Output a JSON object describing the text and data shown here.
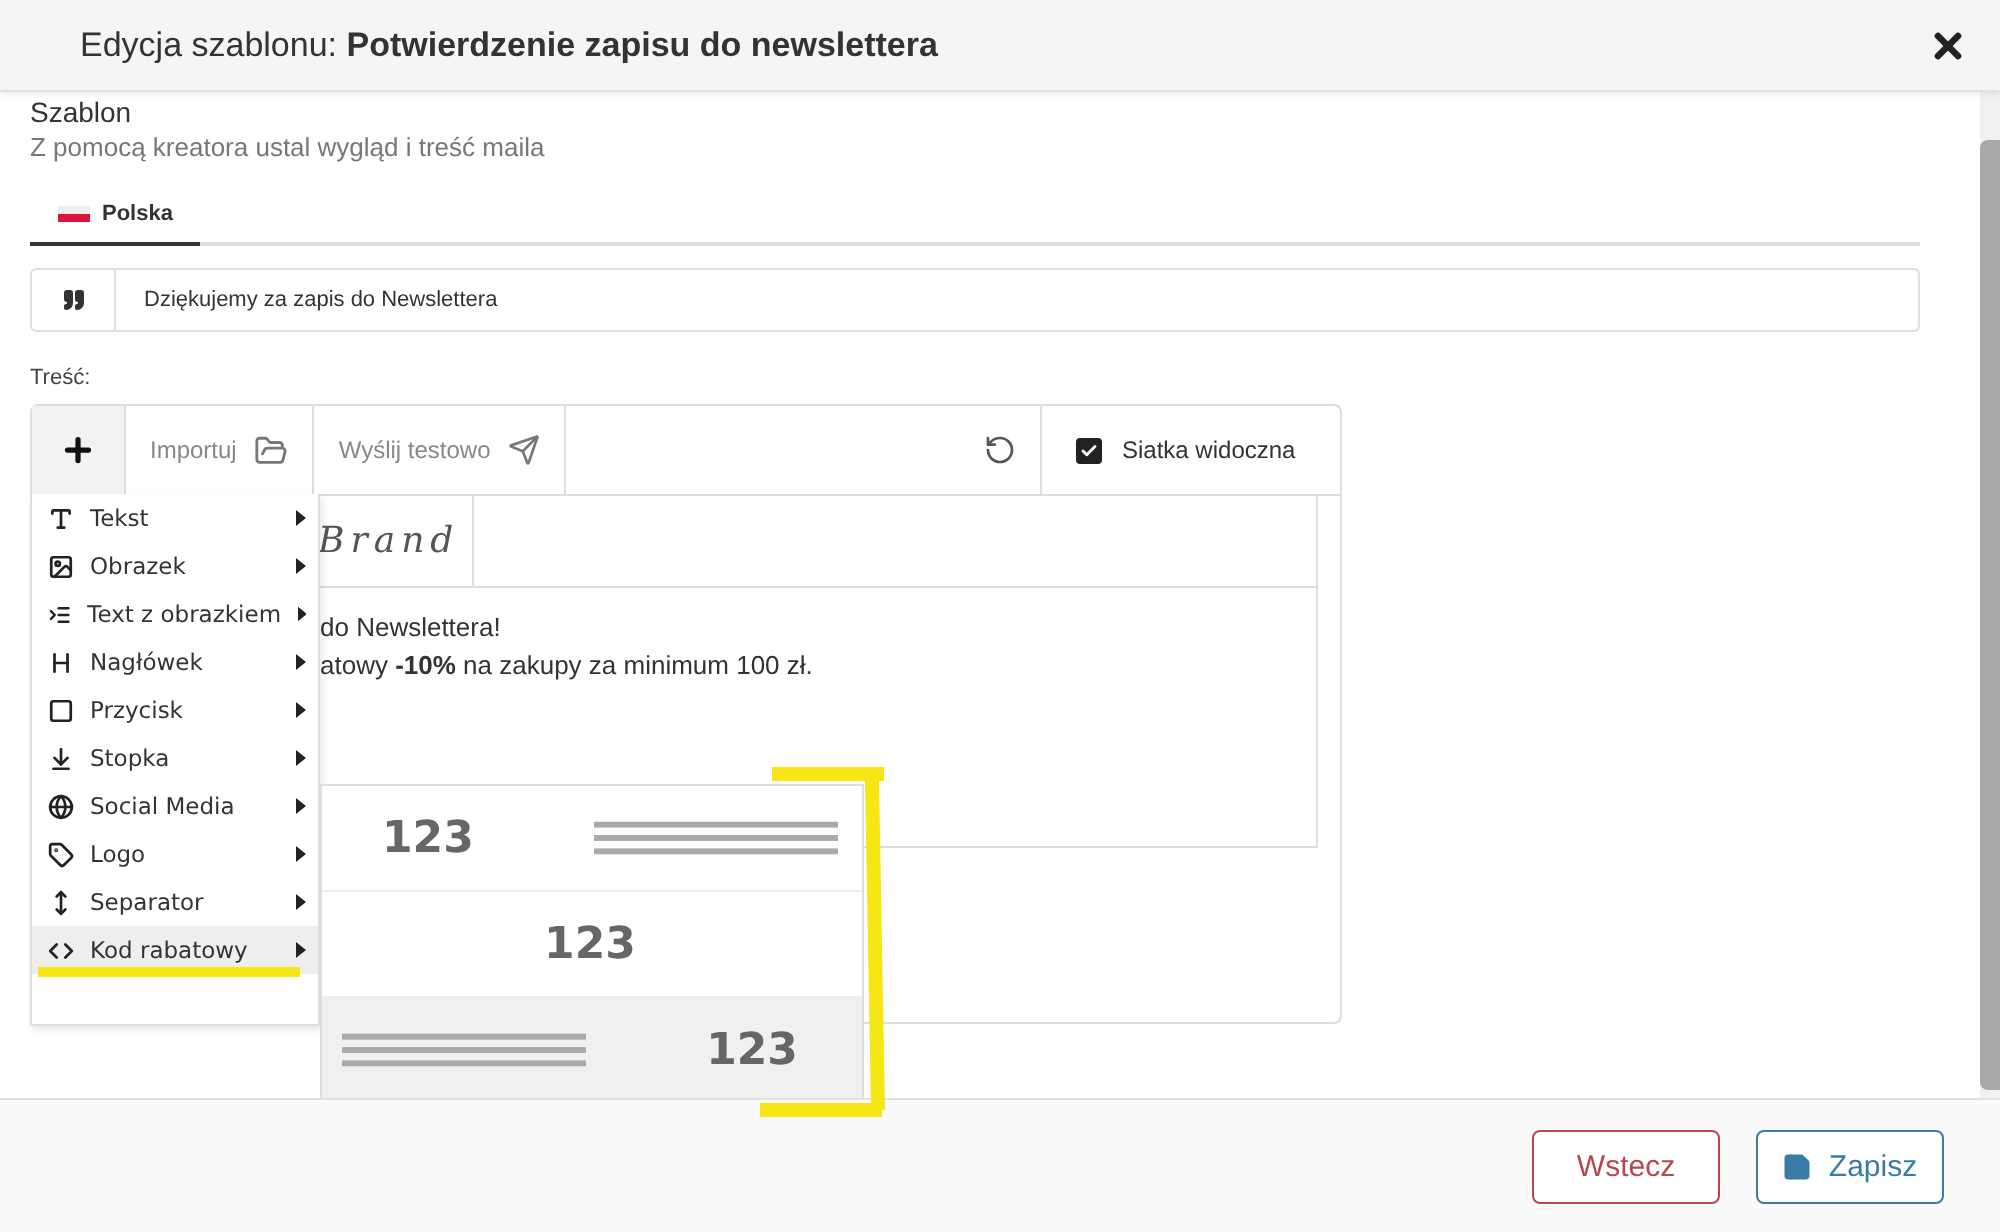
{
  "dialog": {
    "title_prefix": "Edycja szablonu:",
    "title": "Potwierdzenie zapisu do newslettera"
  },
  "section": {
    "heading": "Szablon",
    "subtitle": "Z pomocą kreatora ustal wygląd i treść maila"
  },
  "tabs": [
    {
      "label": "Polska",
      "selected": true
    }
  ],
  "subject_field": {
    "value": "Dziękujemy za zapis do Newslettera"
  },
  "content_label": "Treść:",
  "toolbar": {
    "import": "Importuj",
    "send_test": "Wyślij testowo",
    "grid": {
      "label": "Siatka widoczna",
      "checked": true
    }
  },
  "email_preview": {
    "logo": "Brand",
    "lines": [
      "do Newslettera!",
      "atowy **-10%** na zakupy za minimum 100 zł."
    ]
  },
  "block_menu": [
    {
      "label": "Tekst",
      "selected": false
    },
    {
      "label": "Obrazek",
      "selected": false
    },
    {
      "label": "Text z obrazkiem",
      "selected": false
    },
    {
      "label": "Nagłówek",
      "selected": false
    },
    {
      "label": "Przycisk",
      "selected": false
    },
    {
      "label": "Stopka",
      "selected": false
    },
    {
      "label": "Social Media",
      "selected": false
    },
    {
      "label": "Logo",
      "selected": false
    },
    {
      "label": "Separator",
      "selected": false
    },
    {
      "label": "Kod rabatowy",
      "selected": true
    }
  ],
  "discount_layouts": [
    {
      "kind": "left",
      "code": "123",
      "selected": false
    },
    {
      "kind": "center",
      "code": "123",
      "selected": false
    },
    {
      "kind": "right",
      "code": "123",
      "selected": true
    }
  ],
  "footer": {
    "back": "Wstecz",
    "save": "Zapisz"
  }
}
